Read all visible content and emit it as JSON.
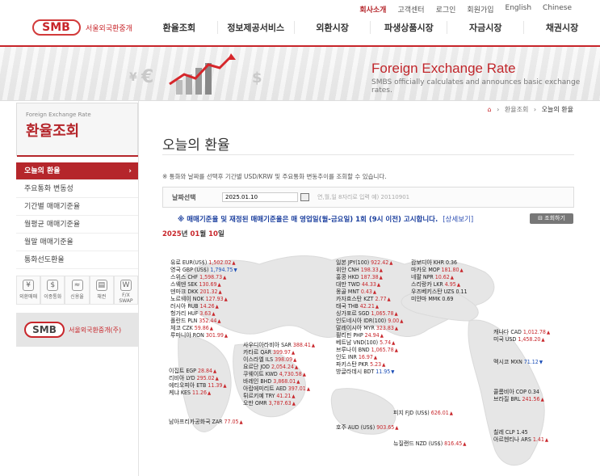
{
  "top_links": [
    "회사소개",
    "고객센터",
    "로그인",
    "회원가입",
    "English",
    "Chinese"
  ],
  "logo": {
    "mark": "SMB",
    "text": "서울외국환중개"
  },
  "main_nav": [
    "환율조회",
    "정보제공서비스",
    "외환시장",
    "파생상품시장",
    "자금시장",
    "채권시장"
  ],
  "banner": {
    "title": "Foreign Exchange Rate",
    "subtitle": "SMBS officially calculates and announces basic exchange rates."
  },
  "sidebar": {
    "en_title": "Foreign Exchange Rate",
    "ko_title": "환율조회",
    "menu": [
      "오늘의 환율",
      "주요통화 변동성",
      "기간별 매매기준율",
      "월평균 매매기준율",
      "월말 매매기준율",
      "통화선도환율"
    ],
    "quick": [
      "외환매매",
      "이종통화",
      "신용율",
      "채권",
      "F/X SWAP"
    ],
    "banner_text": "서울외국환중개(주)"
  },
  "breadcrumb": [
    "환율조회",
    "오늘의 환율"
  ],
  "page_title": "오늘의 환율",
  "note": "※ 통화와 날짜를 선택후 기간별 USD/KRW 및 주요통화 변동추이를 조회할 수 있습니다.",
  "date_select": {
    "label": "날짜선택",
    "value": "2025.01.10",
    "hint": "연,월,일 8자리로 입력 예) 20110901"
  },
  "notice": "※ 매매기준율 및 재정된 매매기준율은 매 영업일(월-금요일) 1회 (9시 이전) 고시합니다.",
  "notice_link": "[상세보기]",
  "view_button": "조회하기",
  "date_stamp": {
    "y": "2025",
    "ytxt": "년",
    "m": "01",
    "mtxt": "월",
    "d": "10",
    "dtxt": "일"
  },
  "rates": [
    {
      "c": "유로 EUR(US$)",
      "v": "1,502.02",
      "d": "up"
    },
    {
      "c": "영국 GBP (US$)",
      "v": "1,794.75",
      "d": "down"
    },
    {
      "c": "스위스 CHF",
      "v": "1,598.73",
      "d": "up"
    },
    {
      "c": "스웨덴 SEK",
      "v": "130.69",
      "d": "up"
    },
    {
      "c": "덴마크 DKK",
      "v": "201.32",
      "d": "up"
    },
    {
      "c": "노르웨이 NOK",
      "v": "127.93",
      "d": "up"
    },
    {
      "c": "러시아 RUB",
      "v": "14.26",
      "d": "up"
    },
    {
      "c": "헝가리 HUF",
      "v": "3.63",
      "d": "up"
    },
    {
      "c": "폴란드 PLN",
      "v": "352.44",
      "d": "up"
    },
    {
      "c": "체코 CZK",
      "v": "59.86",
      "d": "up"
    },
    {
      "c": "루마니아 RON",
      "v": "301.99",
      "d": "up"
    },
    {
      "c": "일본 JPY(100)",
      "v": "922.42",
      "d": "up"
    },
    {
      "c": "위안 CNH",
      "v": "198.33",
      "d": "up"
    },
    {
      "c": "홍콩 HKD",
      "v": "187.38",
      "d": "up"
    },
    {
      "c": "대만 TWD",
      "v": "44.33",
      "d": "up"
    },
    {
      "c": "몽골 MNT",
      "v": "0.43",
      "d": "up"
    },
    {
      "c": "카자흐스탄 KZT",
      "v": "2.77",
      "d": "up"
    },
    {
      "c": "태국 THB",
      "v": "42.21",
      "d": "up"
    },
    {
      "c": "싱가포르 SGD",
      "v": "1,065.78",
      "d": "up"
    },
    {
      "c": "인도네시아 IDR(100)",
      "v": "9.00",
      "d": "up"
    },
    {
      "c": "말레이시아 MYR",
      "v": "323.83",
      "d": "up"
    },
    {
      "c": "필리핀 PHP",
      "v": "24.94",
      "d": "up"
    },
    {
      "c": "베트남 VND(100)",
      "v": "5.74",
      "d": "up"
    },
    {
      "c": "브루나이 BND",
      "v": "1,065.78",
      "d": "up"
    },
    {
      "c": "인도 INR",
      "v": "16.97",
      "d": "up"
    },
    {
      "c": "파키스탄 PKR",
      "v": "5.23",
      "d": "up"
    },
    {
      "c": "방글라데시 BDT",
      "v": "11.95",
      "d": "down"
    },
    {
      "c": "캄보디아 KHR",
      "v": "0.36",
      "d": "flat"
    },
    {
      "c": "마카오 MOP",
      "v": "181.80",
      "d": "up"
    },
    {
      "c": "네팔 NPR",
      "v": "10.62",
      "d": "up"
    },
    {
      "c": "스리랑카 LKR",
      "v": "4.95",
      "d": "up"
    },
    {
      "c": "우즈베키스탄 UZS",
      "v": "0.11",
      "d": "flat"
    },
    {
      "c": "미얀마 MMK",
      "v": "0.69",
      "d": "flat"
    },
    {
      "c": "사우디아라비아 SAR",
      "v": "388.41",
      "d": "up"
    },
    {
      "c": "카타르 QAR",
      "v": "399.97",
      "d": "up"
    },
    {
      "c": "이스라엘 ILS",
      "v": "398.09",
      "d": "up"
    },
    {
      "c": "요르단 JOD",
      "v": "2,054.24",
      "d": "up"
    },
    {
      "c": "쿠웨이트 KWD",
      "v": "4,730.58",
      "d": "up"
    },
    {
      "c": "바레인 BHD",
      "v": "3,868.01",
      "d": "up"
    },
    {
      "c": "아랍에미리트 AED",
      "v": "397.01",
      "d": "up"
    },
    {
      "c": "튀르키예 TRY",
      "v": "41.21",
      "d": "up"
    },
    {
      "c": "오만 OMR",
      "v": "3,787.63",
      "d": "up"
    },
    {
      "c": "이집트 EGP",
      "v": "28.84",
      "d": "up"
    },
    {
      "c": "리비아 LYD",
      "v": "295.02",
      "d": "up"
    },
    {
      "c": "에티오피아 ETB",
      "v": "11.39",
      "d": "up"
    },
    {
      "c": "케냐 KES",
      "v": "11.26",
      "d": "up"
    },
    {
      "c": "남아프리카공화국 ZAR",
      "v": "77.05",
      "d": "up"
    },
    {
      "c": "호주 AUD (US$)",
      "v": "903.65",
      "d": "up"
    },
    {
      "c": "피지 FJD (US$)",
      "v": "626.01",
      "d": "up"
    },
    {
      "c": "뉴질랜드 NZD (US$)",
      "v": "816.45",
      "d": "up"
    },
    {
      "c": "캐나다 CAD",
      "v": "1,012.78",
      "d": "up"
    },
    {
      "c": "미국 USD",
      "v": "1,458.20",
      "d": "up"
    },
    {
      "c": "멕시코 MXN",
      "v": "71.12",
      "d": "down"
    },
    {
      "c": "콜롬비아 COP",
      "v": "0.34",
      "d": "flat"
    },
    {
      "c": "브라질 BRL",
      "v": "241.56",
      "d": "up"
    },
    {
      "c": "칠레 CLP",
      "v": "1.45",
      "d": "flat"
    },
    {
      "c": "아르헨티나 ARS",
      "v": "1.41",
      "d": "up"
    }
  ]
}
